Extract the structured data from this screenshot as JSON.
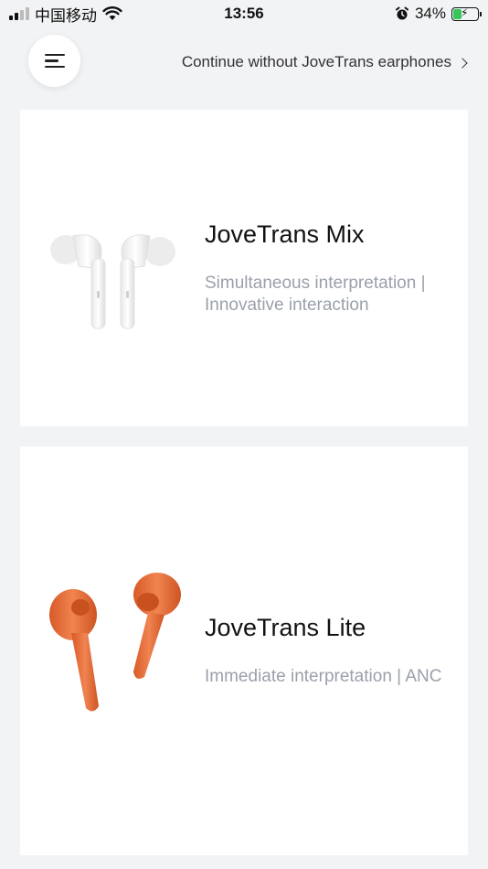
{
  "status_bar": {
    "carrier": "中国移动",
    "time": "13:56",
    "battery_percent": "34%",
    "battery_level": 0.34,
    "icons": [
      "signal-icon",
      "wifi-icon",
      "alarm-icon",
      "battery-icon"
    ]
  },
  "header": {
    "menu_icon": "menu-icon",
    "continue_label": "Continue without JoveTrans earphones"
  },
  "products": [
    {
      "name": "JoveTrans Mix",
      "description": "Simultaneous interpretation | Innovative interaction",
      "image": "white-earbuds-image"
    },
    {
      "name": "JoveTrans Lite",
      "description": "Immediate interpretation | ANC",
      "image": "orange-earbuds-image"
    }
  ],
  "colors": {
    "background": "#f2f3f5",
    "card": "#ffffff",
    "description_text": "#9aa0aa",
    "battery_fill": "#35c759",
    "lite_orange": "#e8703a"
  }
}
